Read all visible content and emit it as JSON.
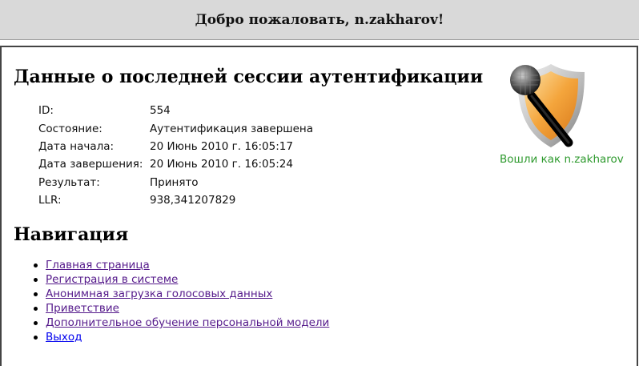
{
  "header": {
    "welcome": "Добро пожаловать, n.zakharov!"
  },
  "session": {
    "title": "Данные о последней сессии аутентификации",
    "rows": [
      {
        "key": "ID:",
        "value": "554"
      },
      {
        "key": "Состояние:",
        "value": "Аутентификация завершена"
      },
      {
        "key": "Дата начала:",
        "value": "20 Июнь 2010 г. 16:05:17"
      },
      {
        "key": "Дата завершения:",
        "value": "20 Июнь 2010 г. 16:05:24"
      },
      {
        "key": "Результат:",
        "value": "Принято"
      },
      {
        "key": "LLR:",
        "value": "938,341207829"
      }
    ]
  },
  "user_panel": {
    "logged_in_as": "Вошли как n.zakharov"
  },
  "navigation": {
    "title": "Навигация",
    "links": [
      "Главная страница",
      "Регистрация в системе",
      "Анонимная загрузка голосовых данных",
      "Приветствие",
      "Дополнительное обучение персональной модели",
      "Выход"
    ]
  },
  "colors": {
    "visited_link": "#551a8b",
    "link": "#0000ee",
    "status_green": "#2e9a2e"
  }
}
